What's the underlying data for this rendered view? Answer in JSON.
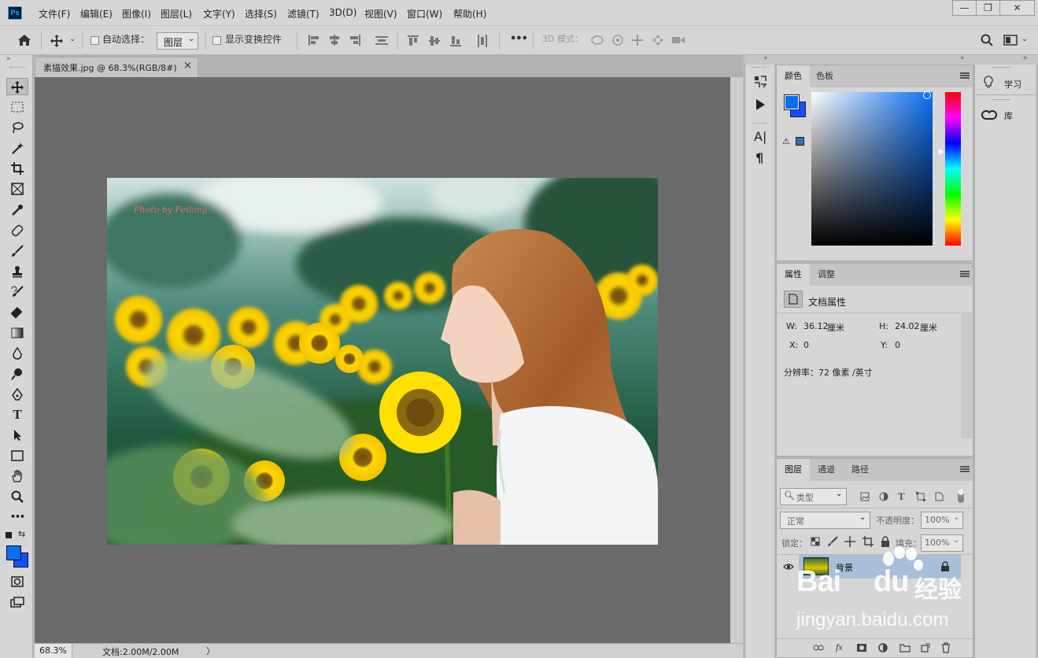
{
  "app": {
    "logo": "Ps"
  },
  "menu": [
    "文件(F)",
    "编辑(E)",
    "图像(I)",
    "图层(L)",
    "文字(Y)",
    "选择(S)",
    "滤镜(T)",
    "3D(D)",
    "视图(V)",
    "窗口(W)",
    "帮助(H)"
  ],
  "window_controls": {
    "minimize": "—",
    "restore": "❐",
    "close": "✕"
  },
  "options": {
    "auto_select_label": "自动选择：",
    "auto_select_value": "图层",
    "show_transform_label": "显示变换控件",
    "mode_3d_label": "3D 模式：",
    "more": "•••"
  },
  "document": {
    "tab_title": "素描效果.jpg @ 68.3%(RGB/8#)",
    "tab_close": "×",
    "watermark": "Photo by Feilong",
    "zoom": "68.3%",
    "doc_size": "文档:2.00M/2.00M",
    "status_arrow": "〉"
  },
  "color_panel": {
    "tabs": [
      "颜色",
      "色板"
    ],
    "fg": "#0a6ef5",
    "bg": "#1350ff"
  },
  "properties_panel": {
    "tabs": [
      "属性",
      "调整"
    ],
    "title": "文档属性",
    "w_label": "W:",
    "w_value": "36.12",
    "w_unit": "厘米",
    "h_label": "H:",
    "h_value": "24.02",
    "h_unit": "厘米",
    "x_label": "X:",
    "x_value": "0",
    "y_label": "Y:",
    "y_value": "0",
    "resolution": "分辨率：72 像素 /英寸"
  },
  "layers_panel": {
    "tabs": [
      "图层",
      "通道",
      "路径"
    ],
    "filter_kind": "类型",
    "blend_mode": "正常",
    "opacity_label": "不透明度：",
    "opacity_value": "100%",
    "lock_label": "锁定：",
    "fill_label": "填充：",
    "fill_value": "100%",
    "layers": [
      {
        "name": "背景",
        "visible": true,
        "locked": true
      }
    ]
  },
  "learn_panel": {
    "items": [
      "学习",
      "库"
    ]
  },
  "baidu_watermark": {
    "main": "Bai",
    "du": "du",
    "jingyan": "经验",
    "url": "jingyan.baidu.com"
  }
}
